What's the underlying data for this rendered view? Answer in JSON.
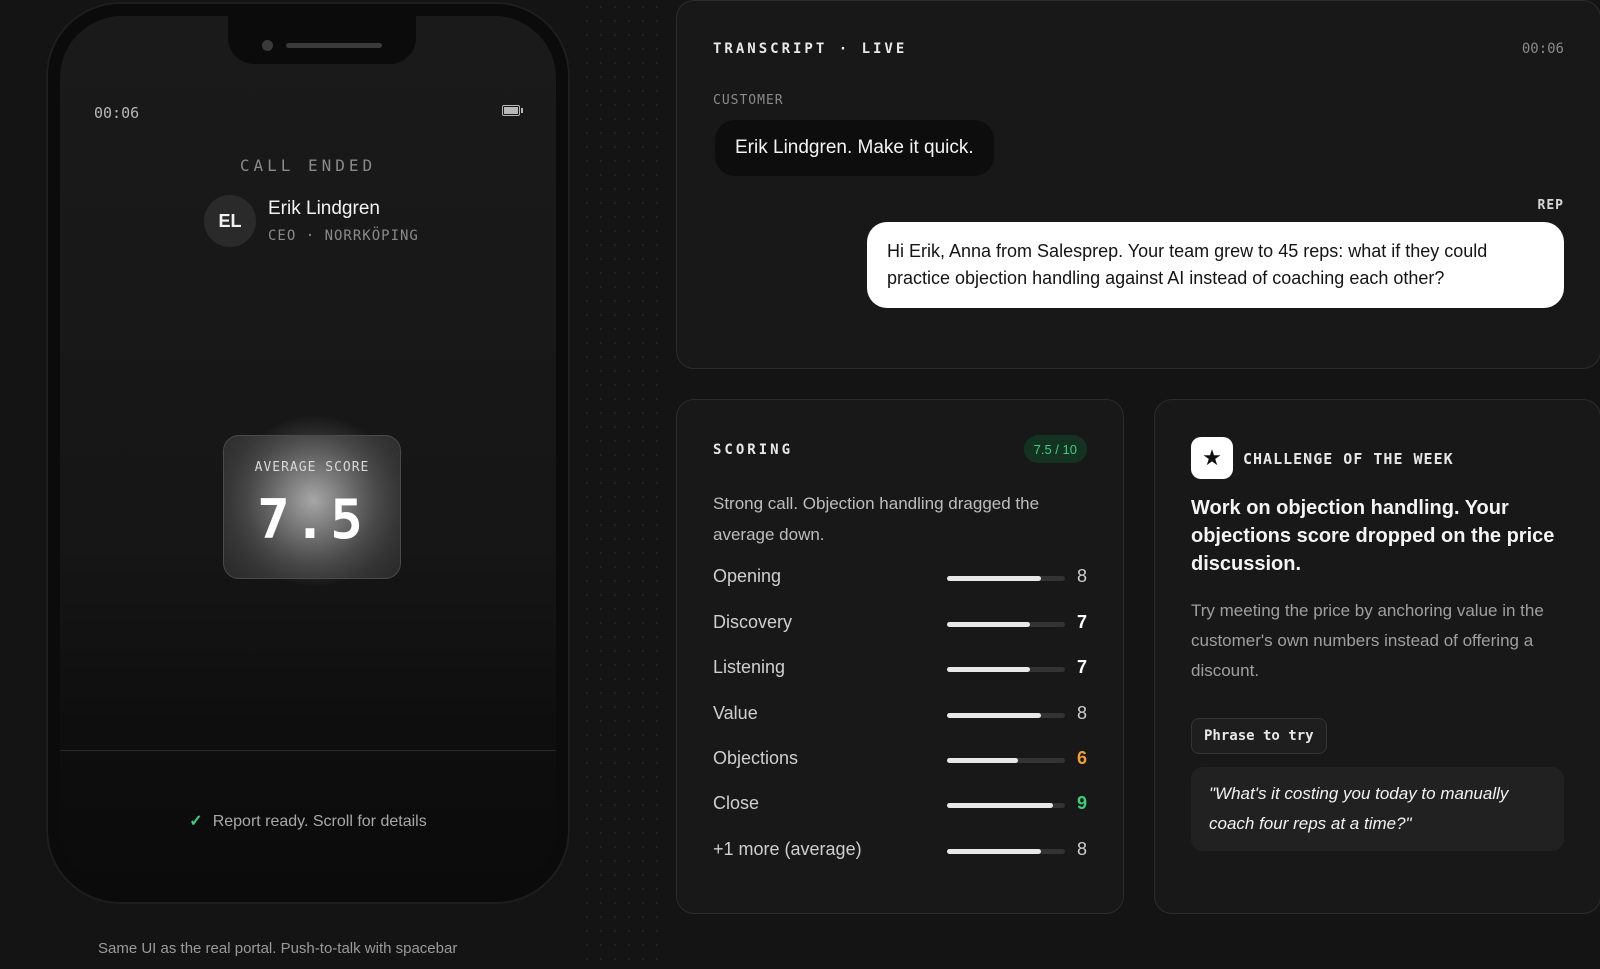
{
  "phone": {
    "time": "00:06",
    "status": "CALL ENDED",
    "contact": {
      "initials": "EL",
      "name": "Erik Lindgren",
      "subtitle": "CEO · NORRKÖPING"
    },
    "score_label": "AVERAGE SCORE",
    "score_value": "7.5",
    "report_text": "Report ready. Scroll for details"
  },
  "caption": "Same UI as the real portal. Push-to-talk with spacebar",
  "transcript": {
    "title": "TRANSCRIPT · LIVE",
    "time": "00:06",
    "customer_label": "CUSTOMER",
    "customer_message": "Erik Lindgren. Make it quick.",
    "rep_label": "REP",
    "rep_message": "Hi Erik, Anna from Salesprep. Your team grew to 45 reps: what if they could practice objection handling against AI instead of coaching each other?"
  },
  "scoring": {
    "title": "SCORING",
    "badge": "7.5 / 10",
    "summary": "Strong call. Objection handling dragged the average down.",
    "metrics": [
      {
        "label": "Opening",
        "value": "8",
        "fill": 0.8,
        "color": "#cfcfcf"
      },
      {
        "label": "Discovery",
        "value": "7",
        "fill": 0.7,
        "color": "#ffffff"
      },
      {
        "label": "Listening",
        "value": "7",
        "fill": 0.7,
        "color": "#ffffff"
      },
      {
        "label": "Value",
        "value": "8",
        "fill": 0.8,
        "color": "#cfcfcf"
      },
      {
        "label": "Objections",
        "value": "6",
        "fill": 0.6,
        "color": "#f0a030"
      },
      {
        "label": "Close",
        "value": "9",
        "fill": 0.9,
        "color": "#3ccf7a"
      },
      {
        "label": "+1 more (average)",
        "value": "8",
        "fill": 0.8,
        "color": "#cfcfcf"
      }
    ]
  },
  "challenge": {
    "icon": "star-icon",
    "title": "CHALLENGE OF THE WEEK",
    "headline": "Work on objection handling. Your objections score dropped on the price discussion.",
    "body": "Try meeting the price by anchoring value in the customer's own numbers instead of offering a discount.",
    "chip": "Phrase to try",
    "quote": "\"What's it costing you today to manually coach four reps at a time?\""
  }
}
